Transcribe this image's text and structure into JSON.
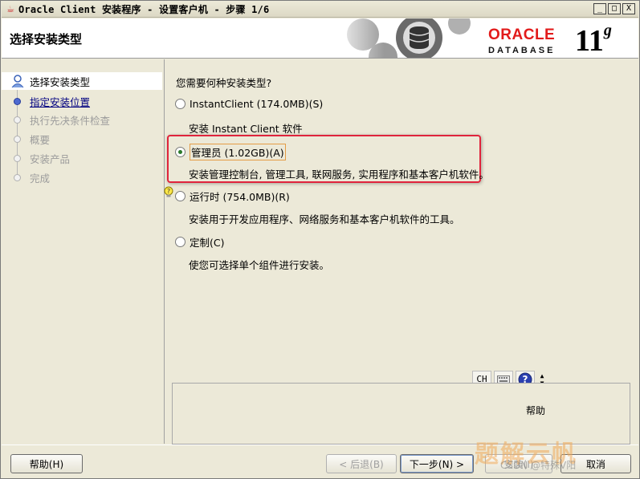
{
  "window": {
    "title": "Oracle Client 安装程序 - 设置客户机 - 步骤 1/6",
    "controls": [
      "_",
      "□",
      "X"
    ]
  },
  "header": {
    "title": "选择安装类型",
    "brand": "ORACLE",
    "product": "DATABASE",
    "version": "11",
    "version_suffix": "g"
  },
  "nav": {
    "items": [
      {
        "label": "选择安装类型",
        "state": "current"
      },
      {
        "label": "指定安装位置",
        "state": "link"
      },
      {
        "label": "执行先决条件检查",
        "state": "disabled"
      },
      {
        "label": "概要",
        "state": "disabled"
      },
      {
        "label": "安装产品",
        "state": "disabled"
      },
      {
        "label": "完成",
        "state": "disabled"
      }
    ]
  },
  "content": {
    "question": "您需要何种安装类型?",
    "options": [
      {
        "label": "InstantClient (174.0MB)(S)",
        "description": "安装 Instant Client 软件",
        "checked": false
      },
      {
        "label": "管理员 (1.02GB)(A)",
        "description": "安装管理控制台, 管理工具, 联网服务, 实用程序和基本客户机软件。",
        "checked": true
      },
      {
        "label": "运行时 (754.0MB)(R)",
        "description": "安装用于开发应用程序、网络服务和基本客户机软件的工具。",
        "checked": false
      },
      {
        "label": "定制(C)",
        "description": "使您可选择单个组件进行安装。",
        "checked": false
      }
    ],
    "ime_label": "CH",
    "help_label": "帮助"
  },
  "buttons": {
    "help": "帮助(H)",
    "back": "< 后退(B)",
    "next": "下一步(N) >",
    "install": "安装(I)",
    "cancel": "取消"
  },
  "watermark": {
    "logo": "题解云帆",
    "text": "CSDN @特殊V阳"
  },
  "colors": {
    "oracle_red": "#e21b1b",
    "highlight_red": "#e0243c",
    "nav_link": "#000080"
  }
}
